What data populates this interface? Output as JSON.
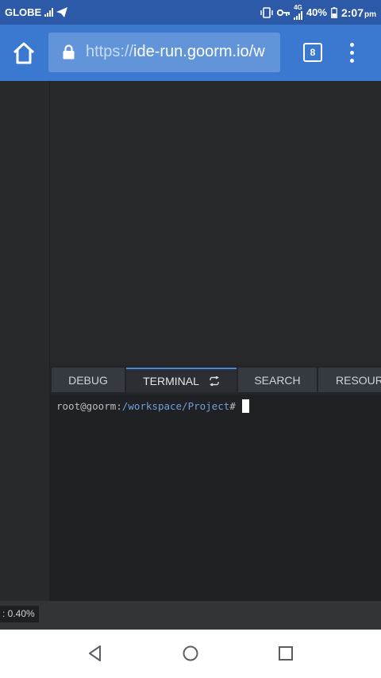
{
  "status_bar": {
    "carrier": "GLOBE",
    "network_type": "4G",
    "battery": "40%",
    "time": "2:07",
    "ampm": "pm",
    "icons": [
      "signal-icon",
      "send-icon",
      "vibrate-icon",
      "key-icon",
      "battery-icon"
    ]
  },
  "browser": {
    "url_scheme": "https://",
    "url_host": "ide-run.goorm.io/w",
    "tab_count": "8",
    "icons": [
      "home-icon",
      "lock-icon",
      "more-vert-icon"
    ],
    "toolbar_color": "#3b79d1"
  },
  "panel": {
    "tabs": [
      {
        "label": "DEBUG"
      },
      {
        "label": "TERMINAL",
        "active": true
      },
      {
        "label": "SEARCH"
      },
      {
        "label": "RESOURC"
      }
    ],
    "accent": "#4b86d6"
  },
  "terminal": {
    "prompt_user": "root@goorm",
    "prompt_sep": ":",
    "prompt_path": "/workspace/Project",
    "prompt_symbol": "#"
  },
  "footer": {
    "zoom_value": ": 0.40%"
  },
  "nav": {
    "icons": [
      "back-icon",
      "home-circle-icon",
      "recents-icon"
    ]
  }
}
